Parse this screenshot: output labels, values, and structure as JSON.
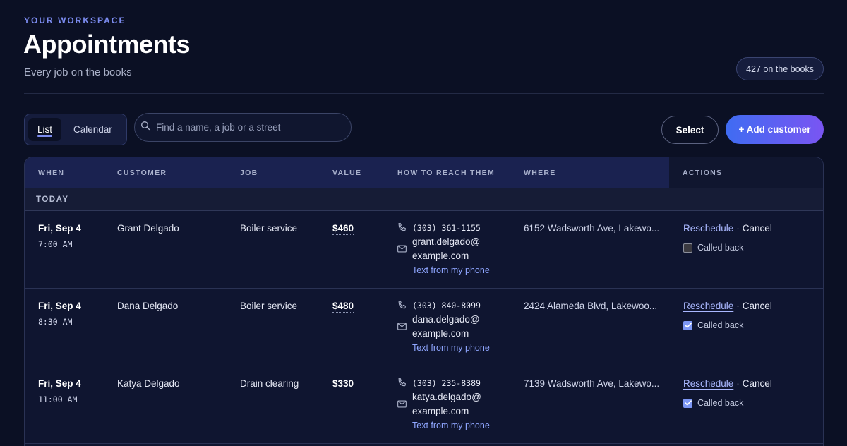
{
  "header": {
    "eyebrow": "YOUR WORKSPACE",
    "title": "Appointments",
    "subtitle": "Every job on the books",
    "count_pill": "427 on the books"
  },
  "toolbar": {
    "view_tabs": [
      {
        "label": "List",
        "active": true
      },
      {
        "label": "Calendar",
        "active": false
      }
    ],
    "search_placeholder": "Find a name, a job or a street",
    "search_value": "",
    "select_label": "Select",
    "add_label": "+ Add customer"
  },
  "table": {
    "columns": [
      "WHEN",
      "CUSTOMER",
      "JOB",
      "VALUE",
      "HOW TO REACH THEM",
      "WHERE",
      "ACTIONS"
    ],
    "group_label": "TODAY",
    "rows": [
      {
        "date": "Fri, Sep 4",
        "time": "7:00 AM",
        "customer": "Grant Delgado",
        "job": "Boiler service",
        "value": "$460",
        "phone": "(303) 361-1155",
        "email_line1": "grant.delgado@",
        "email_line2": "example.com",
        "text_link": "Text from my phone",
        "where": "6152 Wadsworth Ave, Lakewo...",
        "reschedule": "Reschedule",
        "cancel": "Cancel",
        "called_back_label": "Called back",
        "called_back": false
      },
      {
        "date": "Fri, Sep 4",
        "time": "8:30 AM",
        "customer": "Dana Delgado",
        "job": "Boiler service",
        "value": "$480",
        "phone": "(303) 840-8099",
        "email_line1": "dana.delgado@",
        "email_line2": "example.com",
        "text_link": "Text from my phone",
        "where": "2424 Alameda Blvd, Lakewoo...",
        "reschedule": "Reschedule",
        "cancel": "Cancel",
        "called_back_label": "Called back",
        "called_back": true
      },
      {
        "date": "Fri, Sep 4",
        "time": "11:00 AM",
        "customer": "Katya Delgado",
        "job": "Drain clearing",
        "value": "$330",
        "phone": "(303) 235-8389",
        "email_line1": "katya.delgado@",
        "email_line2": "example.com",
        "text_link": "Text from my phone",
        "where": "7139 Wadsworth Ave, Lakewo...",
        "reschedule": "Reschedule",
        "cancel": "Cancel",
        "called_back_label": "Called back",
        "called_back": true
      }
    ]
  },
  "icons": {
    "search": "search-icon",
    "phone": "phone-icon",
    "mail": "mail-icon",
    "check": "check-icon"
  },
  "colors": {
    "accent": "#7c8cf0",
    "primary_gradient_start": "#3f6cf2",
    "primary_gradient_end": "#7a55f2",
    "link": "#8fa6ff",
    "checkbox_checked": "#7d97f5"
  }
}
